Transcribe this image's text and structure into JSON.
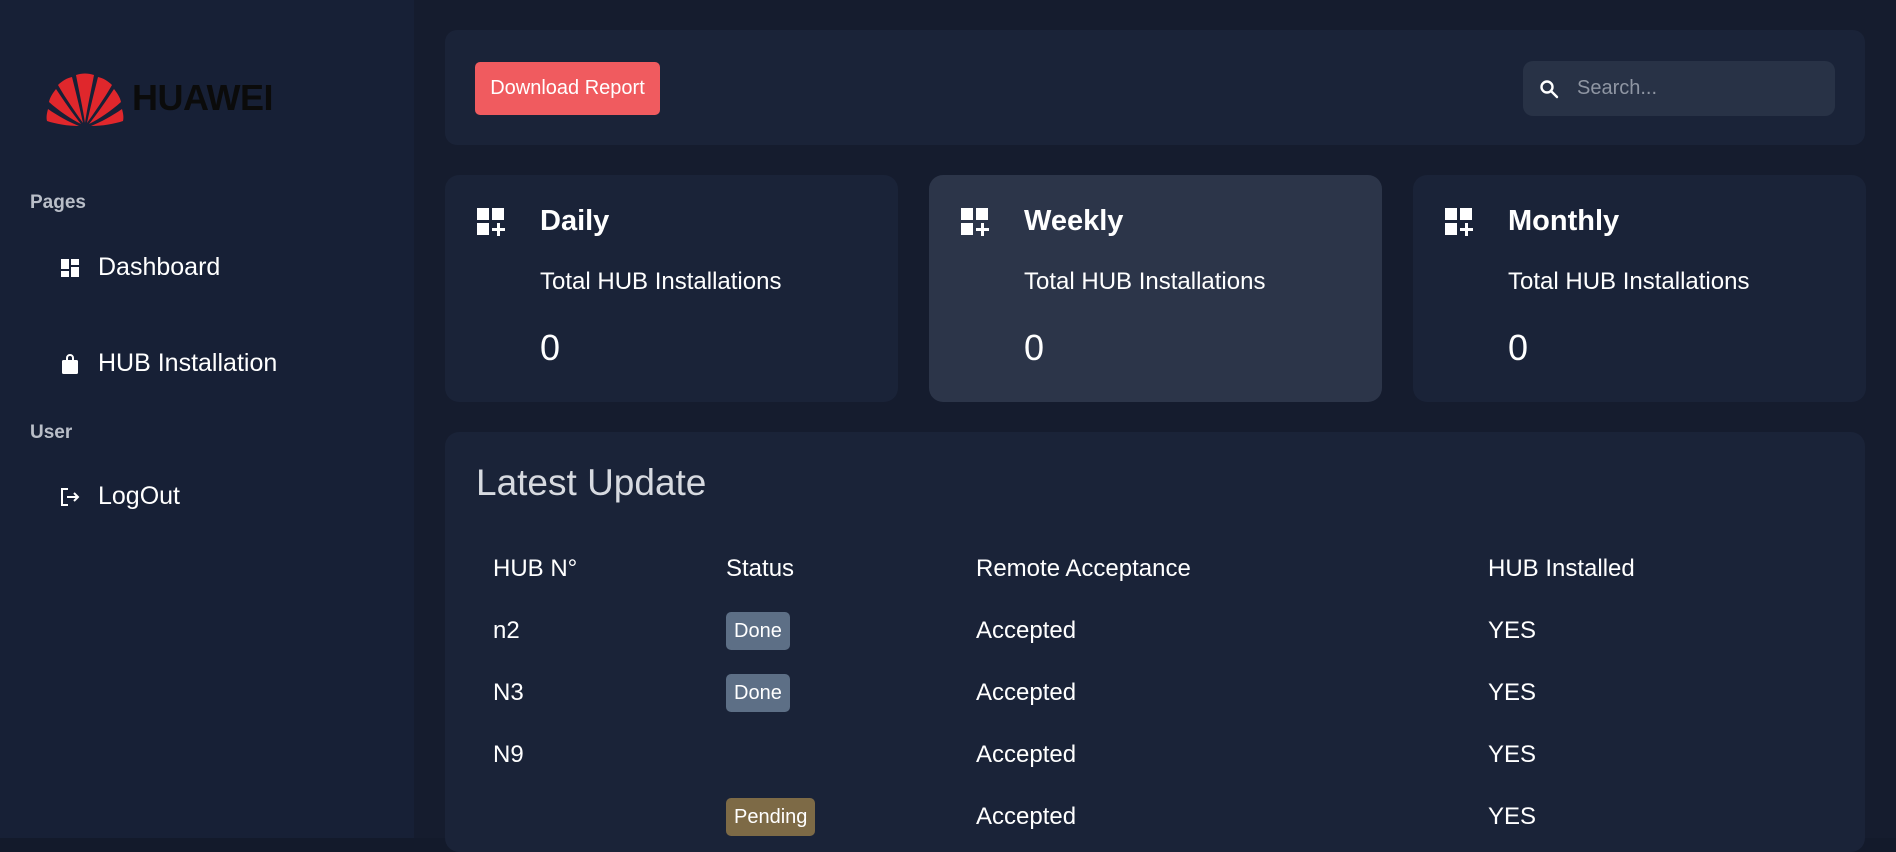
{
  "brand": {
    "name": "HUAWEI",
    "logo_color": "#e0272c"
  },
  "sidebar": {
    "sections": [
      {
        "title": "Pages"
      },
      {
        "title": "User"
      }
    ],
    "items": [
      {
        "label": "Dashboard",
        "icon": "dashboard-icon"
      },
      {
        "label": "HUB Installation",
        "icon": "bag-icon"
      },
      {
        "label": "LogOut",
        "icon": "logout-icon"
      }
    ]
  },
  "toolbar": {
    "download_label": "Download Report",
    "download_color": "#f05b5f",
    "search_placeholder": "Search...",
    "search_value": ""
  },
  "cards": [
    {
      "title": "Daily",
      "subtitle": "Total HUB Installations",
      "value": "0",
      "icon": "dashboard-add-icon"
    },
    {
      "title": "Weekly",
      "subtitle": "Total HUB Installations",
      "value": "0",
      "icon": "dashboard-add-icon"
    },
    {
      "title": "Monthly",
      "subtitle": "Total HUB Installations",
      "value": "0",
      "icon": "dashboard-add-icon"
    }
  ],
  "table": {
    "title": "Latest Update",
    "headers": [
      "HUB N°",
      "Status",
      "Remote Acceptance",
      "HUB Installed"
    ],
    "rows": [
      {
        "hub": "n2",
        "status": "Done",
        "remote": "Accepted",
        "installed": "YES"
      },
      {
        "hub": "N3",
        "status": "Done",
        "remote": "Accepted",
        "installed": "YES"
      },
      {
        "hub": "N9",
        "status": "",
        "remote": "Accepted",
        "installed": "YES"
      },
      {
        "hub": "",
        "status": "Pending",
        "remote": "Accepted",
        "installed": "YES"
      }
    ]
  }
}
